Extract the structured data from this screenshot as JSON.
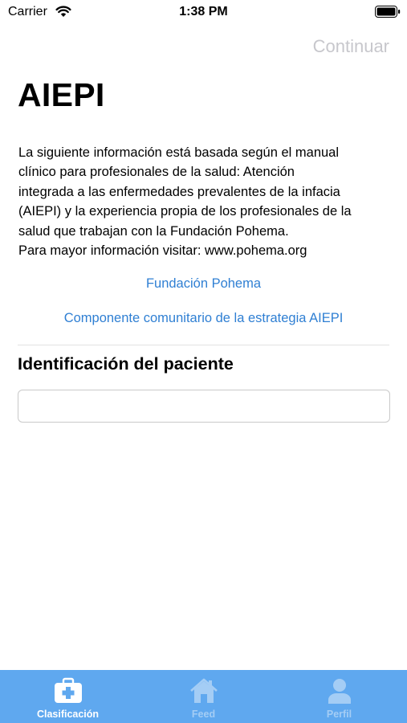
{
  "status_bar": {
    "carrier": "Carrier",
    "time": "1:38 PM"
  },
  "nav": {
    "continue_label": "Continuar"
  },
  "title": "AIEPI",
  "description": "La siguiente información está basada según el manual\nclínico para profesionales de la salud: Atención\nintegrada a las enfermedades prevalentes de la infacia\n(AIEPI) y la experiencia propia de los profesionales de la\nsalud que trabajan con la Fundación Pohema.\nPara mayor información visitar: www.pohema.org",
  "links": {
    "pohema": "Fundación Pohema",
    "componente": "Componente comunitario de la estrategia AIEPI"
  },
  "patient": {
    "label": "Identificación del paciente",
    "value": "",
    "placeholder": ""
  },
  "tab_bar": {
    "tabs": [
      {
        "label": "Clasificación",
        "icon": "medical-kit-icon",
        "active": true
      },
      {
        "label": "Feed",
        "icon": "home-icon",
        "active": false
      },
      {
        "label": "Perfil",
        "icon": "person-icon",
        "active": false
      }
    ]
  },
  "colors": {
    "accent": "#2f7fd3",
    "tab_bar_background": "#5fa8ef",
    "tab_inactive": "#a4cdf5",
    "disabled_nav": "#c7c7cc"
  }
}
